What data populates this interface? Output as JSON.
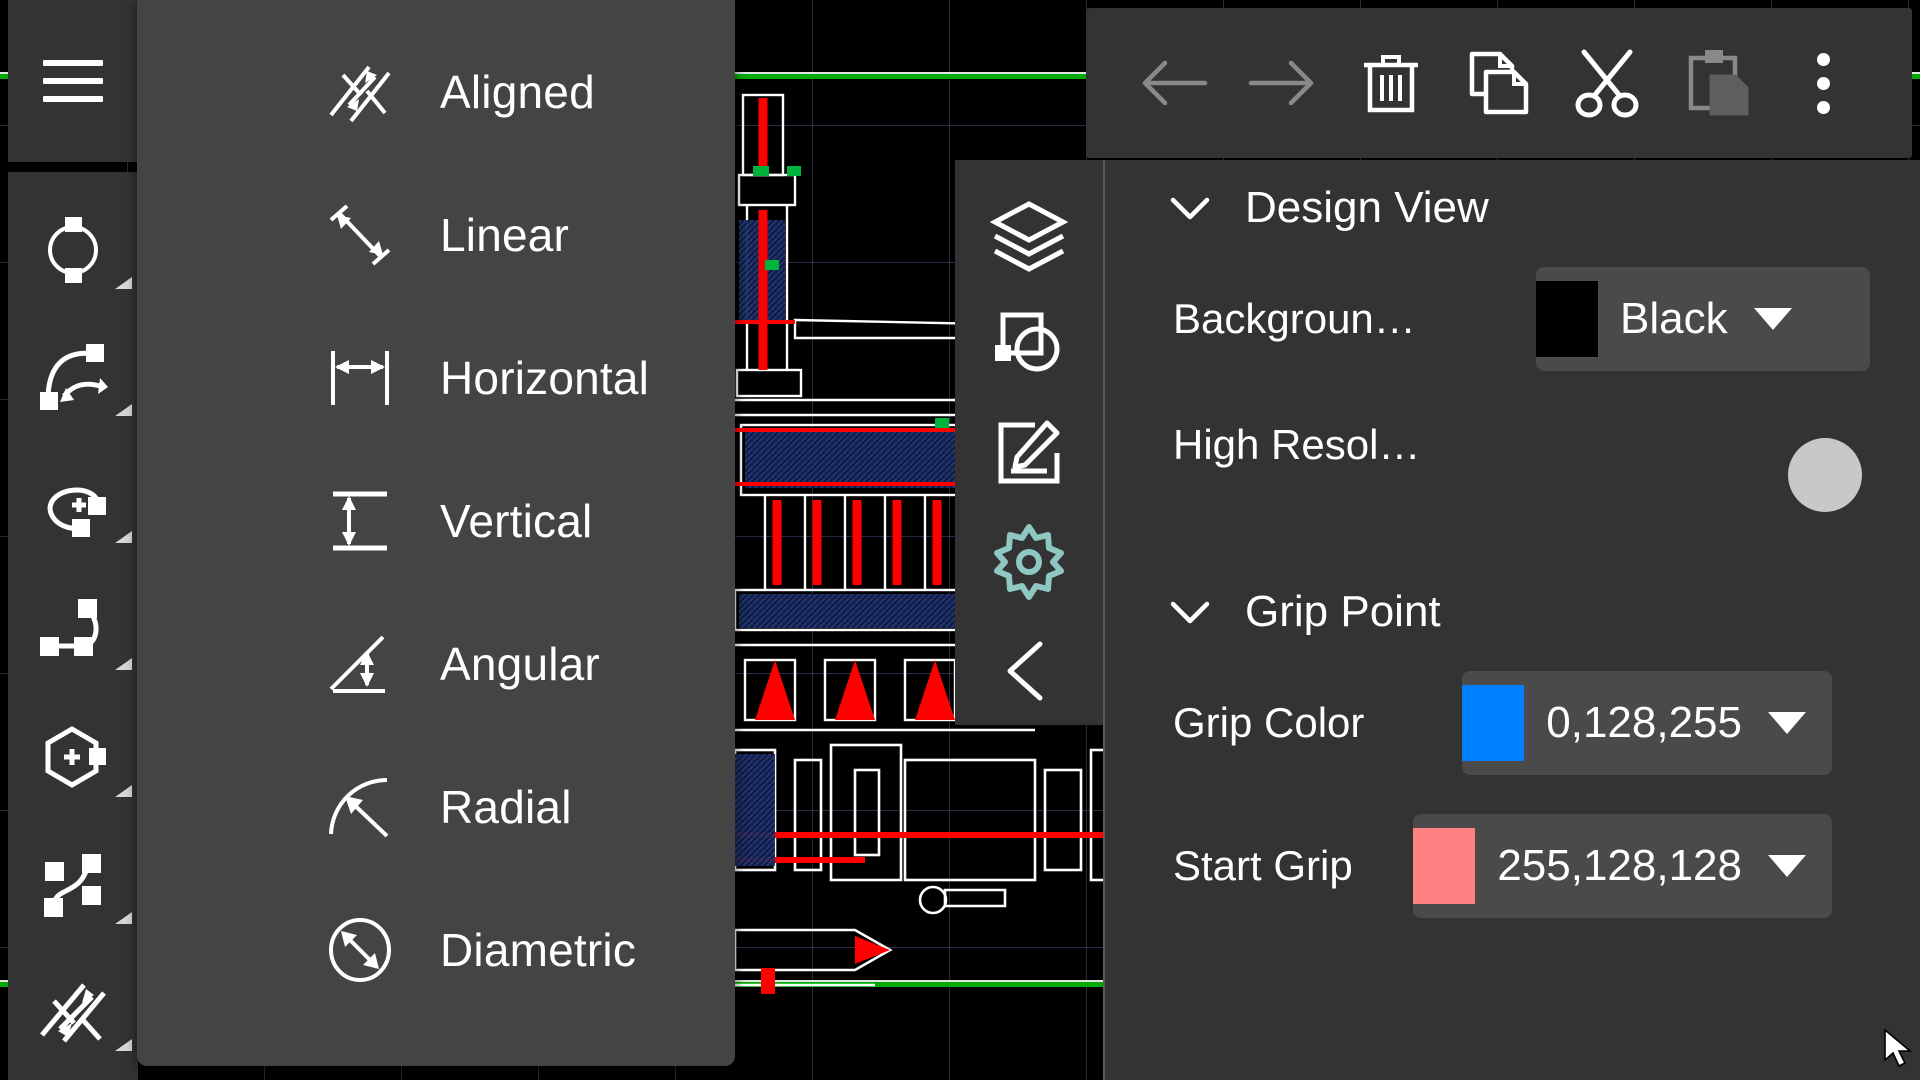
{
  "app": {
    "title": "CAD Drawing Editor"
  },
  "left_sidebar": {
    "menu_button": {
      "name": "hamburger-menu",
      "label": "Menu"
    },
    "tools": [
      {
        "id": "circle",
        "label": "Circle",
        "icon": "circle-grip-icon",
        "has_submenu": true,
        "active": false
      },
      {
        "id": "arc",
        "label": "Arc",
        "icon": "arc-icon",
        "has_submenu": true,
        "active": false
      },
      {
        "id": "arc-plus",
        "label": "Arc Add",
        "icon": "arc-plus-icon",
        "has_submenu": true,
        "active": false
      },
      {
        "id": "polyline",
        "label": "Polyline",
        "icon": "polyline-icon",
        "has_submenu": true,
        "active": false
      },
      {
        "id": "polygon",
        "label": "Polygon",
        "icon": "polygon-plus-icon",
        "has_submenu": true,
        "active": false
      },
      {
        "id": "spline",
        "label": "Spline",
        "icon": "spline-icon",
        "has_submenu": true,
        "active": false
      },
      {
        "id": "dimension",
        "label": "Dimension",
        "icon": "dimension-icon",
        "has_submenu": true,
        "active": true
      }
    ]
  },
  "dimension_menu": {
    "open": true,
    "items": [
      {
        "label": "Aligned",
        "icon": "dimension-aligned-icon"
      },
      {
        "label": "Linear",
        "icon": "dimension-linear-icon"
      },
      {
        "label": "Horizontal",
        "icon": "dimension-horizontal-icon"
      },
      {
        "label": "Vertical",
        "icon": "dimension-vertical-icon"
      },
      {
        "label": "Angular",
        "icon": "dimension-angular-icon"
      },
      {
        "label": "Radial",
        "icon": "dimension-radial-icon"
      },
      {
        "label": "Diametric",
        "icon": "dimension-diametric-icon"
      }
    ]
  },
  "top_toolbar": {
    "buttons": [
      {
        "id": "undo",
        "label": "Undo",
        "icon": "arrow-left-icon",
        "enabled": false
      },
      {
        "id": "redo",
        "label": "Redo",
        "icon": "arrow-right-icon",
        "enabled": false
      },
      {
        "id": "delete",
        "label": "Delete",
        "icon": "trash-icon",
        "enabled": true
      },
      {
        "id": "copy",
        "label": "Copy",
        "icon": "copy-icon",
        "enabled": true
      },
      {
        "id": "cut",
        "label": "Cut",
        "icon": "scissors-icon",
        "enabled": true
      },
      {
        "id": "paste",
        "label": "Paste",
        "icon": "paste-icon",
        "enabled": false
      },
      {
        "id": "more",
        "label": "More options",
        "icon": "more-vertical-icon",
        "enabled": true
      }
    ]
  },
  "middle_toolbar": {
    "buttons": [
      {
        "id": "layers",
        "label": "Layers",
        "icon": "layers-icon",
        "active": false
      },
      {
        "id": "objects",
        "label": "Objects",
        "icon": "object-snap-icon",
        "active": false
      },
      {
        "id": "annotate",
        "label": "Annotate",
        "icon": "edit-square-icon",
        "active": false
      },
      {
        "id": "settings",
        "label": "Settings",
        "icon": "gear-icon",
        "active": true
      },
      {
        "id": "collapse",
        "label": "Collapse",
        "icon": "chevron-left-icon",
        "active": false
      }
    ],
    "active_color": "#8fc7c2"
  },
  "settings_panel": {
    "sections": [
      {
        "title": "Design View",
        "expanded": true,
        "rows": [
          {
            "label": "Backgroun…",
            "type": "color-dropdown",
            "value": "Black",
            "swatch": "#000000"
          },
          {
            "label": "High Resol…",
            "type": "toggle",
            "value": "off"
          }
        ]
      },
      {
        "title": "Grip Point",
        "expanded": true,
        "rows": [
          {
            "label": "Grip Color",
            "type": "color-dropdown",
            "value": "0,128,255",
            "swatch": "#0080ff"
          },
          {
            "label": "Start Grip",
            "type": "color-dropdown",
            "value": "255,128,128",
            "swatch": "#ff8080"
          }
        ]
      }
    ]
  },
  "canvas": {
    "background": "#000000",
    "grid_color": "#484e76",
    "guide_line_color": "#00aa00",
    "drawing_colors": {
      "outline": "#ffffff",
      "centerline": "#ff0000",
      "hatch": "#1b2a5e",
      "node": "#00b33c"
    }
  }
}
